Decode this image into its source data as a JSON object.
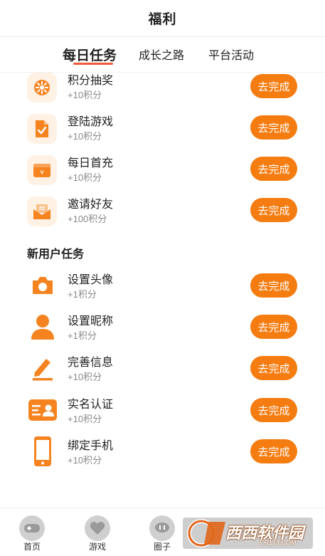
{
  "header": {
    "title": "福利"
  },
  "tabs": [
    {
      "label": "每日任务",
      "active": true
    },
    {
      "label": "成长之路",
      "active": false
    },
    {
      "label": "平台活动",
      "active": false
    }
  ],
  "daily_tasks": [
    {
      "name": "积分抽奖",
      "points": "+10积分",
      "button": "去完成",
      "icon": "wheel-icon"
    },
    {
      "name": "登陆游戏",
      "points": "+10积分",
      "button": "去完成",
      "icon": "document-check-icon"
    },
    {
      "name": "每日首充",
      "points": "+10积分",
      "button": "去完成",
      "icon": "wallet-icon"
    },
    {
      "name": "邀请好友",
      "points": "+100积分",
      "button": "去完成",
      "icon": "envelope-icon"
    }
  ],
  "new_user_section": {
    "title": "新用户任务"
  },
  "new_user_tasks": [
    {
      "name": "设置头像",
      "points": "+1积分",
      "button": "去完成",
      "icon": "camera-icon"
    },
    {
      "name": "设置昵称",
      "points": "+1积分",
      "button": "去完成",
      "icon": "person-icon"
    },
    {
      "name": "完善信息",
      "points": "+10积分",
      "button": "去完成",
      "icon": "pencil-icon"
    },
    {
      "name": "实名认证",
      "points": "+10积分",
      "button": "去完成",
      "icon": "id-card-icon"
    },
    {
      "name": "绑定手机",
      "points": "+10积分",
      "button": "去完成",
      "icon": "phone-icon"
    }
  ],
  "bottom_nav": [
    {
      "label": "首页",
      "icon": "gamepad-icon"
    },
    {
      "label": "游戏",
      "icon": "heart-icon"
    },
    {
      "label": "圈子",
      "icon": "chat-icon"
    }
  ],
  "watermark": {
    "text": "西西软件园",
    "sub": "CR173.COM"
  },
  "colors": {
    "accent": "#f57c10",
    "tab_underline": "#f05a38",
    "icon_bg": "#fff1e4"
  }
}
